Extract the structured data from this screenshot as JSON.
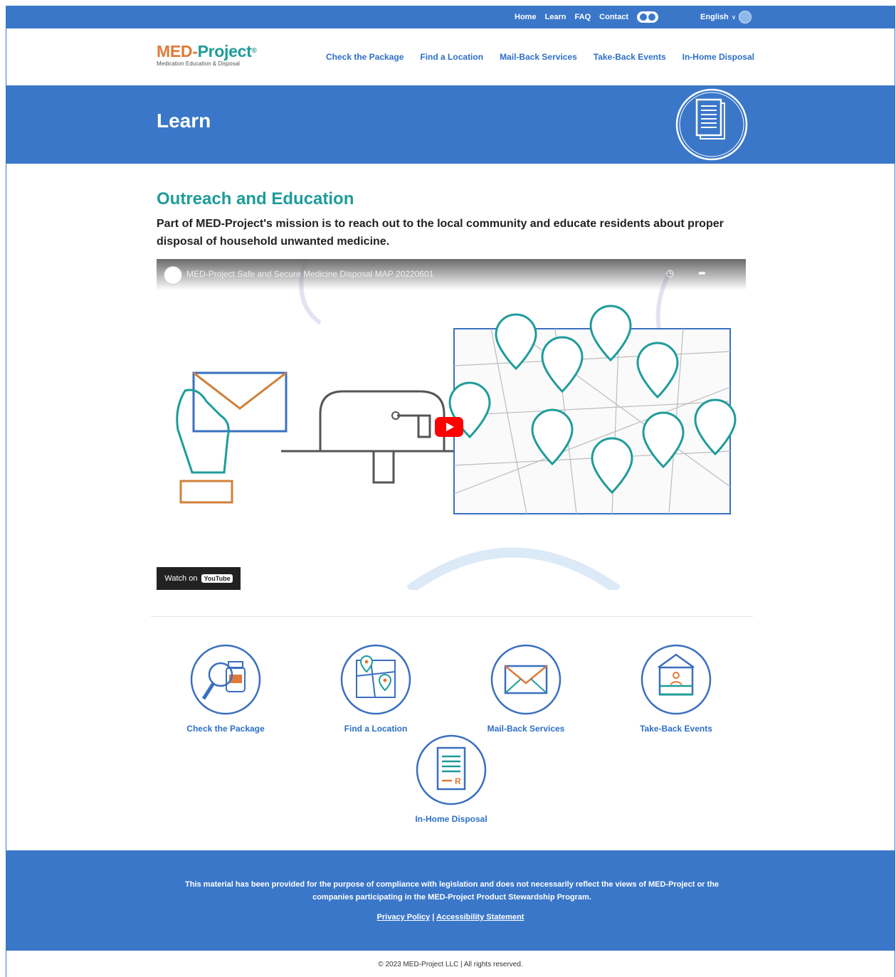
{
  "topbar": {
    "links": [
      "Home",
      "Learn",
      "FAQ",
      "Contact"
    ],
    "language": "English"
  },
  "header": {
    "logo": {
      "brand_a": "MED",
      "dash": "-",
      "brand_b": "Project",
      "reg": "®",
      "tagline": "Medication Education & Disposal"
    },
    "nav": [
      "Check the Package",
      "Find a Location",
      "Mail-Back Services",
      "Take-Back Events",
      "In-Home Disposal"
    ]
  },
  "hero": {
    "title": "Learn"
  },
  "main": {
    "section_title": "Outreach and Education",
    "intro": "Part of MED-Project's mission is to reach out to the local community and educate residents about proper disposal of household unwanted medicine.",
    "video": {
      "title": "MED-Project Safe and Secure Medicine Disposal MAP 20220601",
      "watch_on": "Watch on",
      "youtube": "YouTube"
    }
  },
  "quicklinks": [
    {
      "label": "Check the Package",
      "icon": "magnifier-pill-bottle-icon"
    },
    {
      "label": "Find a Location",
      "icon": "map-pin-icon"
    },
    {
      "label": "Mail-Back Services",
      "icon": "envelope-icon"
    },
    {
      "label": "Take-Back Events",
      "icon": "booth-icon"
    },
    {
      "label": "In-Home Disposal",
      "icon": "prescription-icon"
    }
  ],
  "footer": {
    "disclaimer": "This material has been provided for the purpose of compliance with legislation and does not necessarily reflect the views of MED-Project or the companies participating in the MED-Project Product Stewardship Program.",
    "privacy": "Privacy Policy",
    "separator": "|",
    "accessibility": "Accessibility Statement",
    "copyright": "© 2023 MED-Project LLC | All rights reserved."
  },
  "colors": {
    "brand_blue": "#3a77c9",
    "teal": "#1e9c9a",
    "orange": "#e0793a",
    "link_blue": "#2c6fc7"
  }
}
